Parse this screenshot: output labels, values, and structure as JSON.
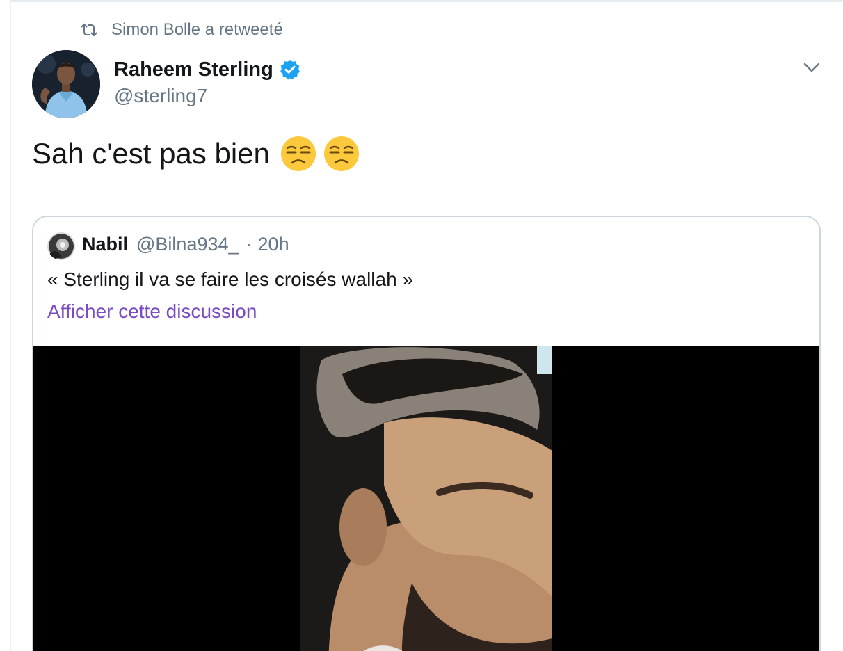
{
  "retweet": {
    "icon": "retweet-icon",
    "label": "Simon Bolle a retweeté"
  },
  "tweet": {
    "author": {
      "display_name": "Raheem Sterling",
      "handle": "@sterling7",
      "verified": true,
      "avatar": "avatar-photo"
    },
    "menu_icon": "chevron-down-icon",
    "text": "Sah c'est pas bien",
    "emojis": [
      "unamused-face",
      "unamused-face"
    ]
  },
  "quoted_tweet": {
    "author": {
      "display_name": "Nabil",
      "handle": "@Bilna934_",
      "avatar": "avatar-photo"
    },
    "separator": "·",
    "time": "20h",
    "text": "« Sterling il va se faire les croisés wallah »",
    "show_thread_link": "Afficher cette discussion",
    "media": "video-thumbnail"
  },
  "colors": {
    "text_primary": "#14171a",
    "text_secondary": "#657786",
    "verified_blue": "#1da1f2",
    "link_purple": "#794bc4",
    "border": "#ccd6dd"
  }
}
